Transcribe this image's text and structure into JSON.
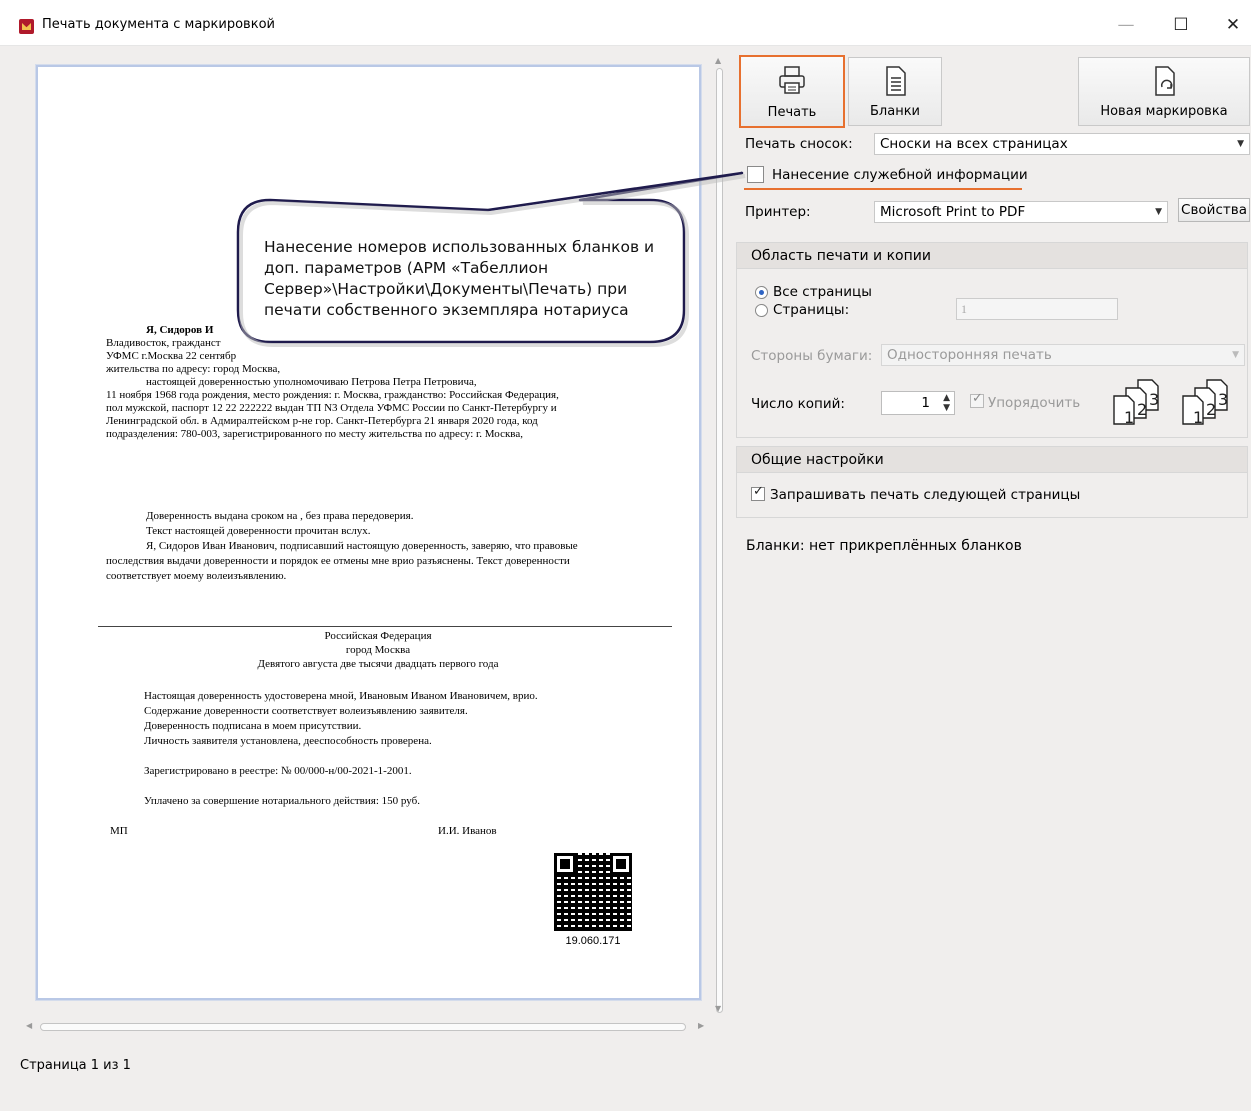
{
  "window": {
    "title": "Печать документа с маркировкой",
    "minimize": "—",
    "maximize": "☐",
    "close": "✕"
  },
  "toolbar": {
    "print_label": "Печать",
    "blanks_label": "Бланки",
    "new_marking_label": "Новая маркировка"
  },
  "footnotes": {
    "label": "Печать сносок:",
    "value": "Сноски на всех страницах"
  },
  "service_info": {
    "label": "Нанесение служебной информации",
    "checked": false
  },
  "printer": {
    "label": "Принтер:",
    "value": "Microsoft Print to PDF",
    "properties_label": "Свойства"
  },
  "print_area": {
    "header": "Область печати и копии",
    "all_pages_label": "Все страницы",
    "pages_label": "Страницы:",
    "pages_value": "1",
    "sides_label": "Стороны бумаги:",
    "sides_value": "Односторонняя печать",
    "copies_label": "Число копий:",
    "copies_value": "1",
    "collate_label": "Упорядочить"
  },
  "general": {
    "header": "Общие настройки",
    "ask_next_page_label": "Запрашивать печать следующей страницы"
  },
  "blanks_status": "Бланки: нет прикреплённых бланков",
  "status_bar": "Страница 1 из 1",
  "callout": {
    "text": "Нанесение номеров использованных бланков и доп. параметров (АРМ «Табеллион Сервер»\\Настройки\\Документы\\Печать) при печати собственного экземпляра нотариуса"
  },
  "document": {
    "p1_a": "Я,  Сидоров  И",
    "p1_b": "Владивосток,  гражданст",
    "p1_c": "УФМС  г.Москва  22 сентябр",
    "p1_d": "жительства по адресу: город Москва,",
    "p2_a": "настоящей      доверенностью      уполномочиваю      Петрова      Петра      Петровича,",
    "p2_b": "11 ноября 1968 года рождения, место рождения: г. Москва, гражданство: Российская Федерация,",
    "p2_c": "пол мужской, паспорт 12 22 222222 выдан ТП N3 Отдела УФМС России по Санкт-Петербургу и",
    "p2_d": "Ленинградской  обл.  в  Адмиралтейском  р-не  гор.  Санкт-Петербурга  21 января 2020 года,  код",
    "p2_e": "подразделения: 780-003, зарегистрированного по месту жительства по адресу: г. Москва,",
    "p3_a": "Доверенность выдана сроком на , без права передоверия.",
    "p3_b": "Текст настоящей доверенности прочитан вслух.",
    "p3_c": "Я, Сидоров Иван Иванович, подписавший настоящую доверенность, заверяю, что правовые",
    "p3_d": "последствия выдачи доверенности и порядок ее отмены мне врио разъяснены. Текст доверенности",
    "p3_e": "соответствует моему волеизъявлению.",
    "c1": "Российская Федерация",
    "c2": "город Москва",
    "c3": "Девятого августа две тысячи двадцать первого года",
    "n1": "Настоящая доверенность удостоверена мной, Ивановым Иваном Ивановичем, врио.",
    "n2": "Содержание доверенности соответствует волеизъявлению заявителя.",
    "n3": "Доверенность подписана в моем присутствии.",
    "n4": "Личность заявителя установлена, дееспособность проверена.",
    "reg": "Зарегистрировано в реестре: № 00/000-н/00-2021-1-2001.",
    "paid": "Уплачено за совершение нотариального действия: 150 руб.",
    "mp": "МП",
    "signer": "И.И. Иванов",
    "qr_number": "19.060.171"
  },
  "colors": {
    "highlight": "#e7702f",
    "window_bg": "#f0eeed",
    "radio_accent": "#2f64c4"
  }
}
